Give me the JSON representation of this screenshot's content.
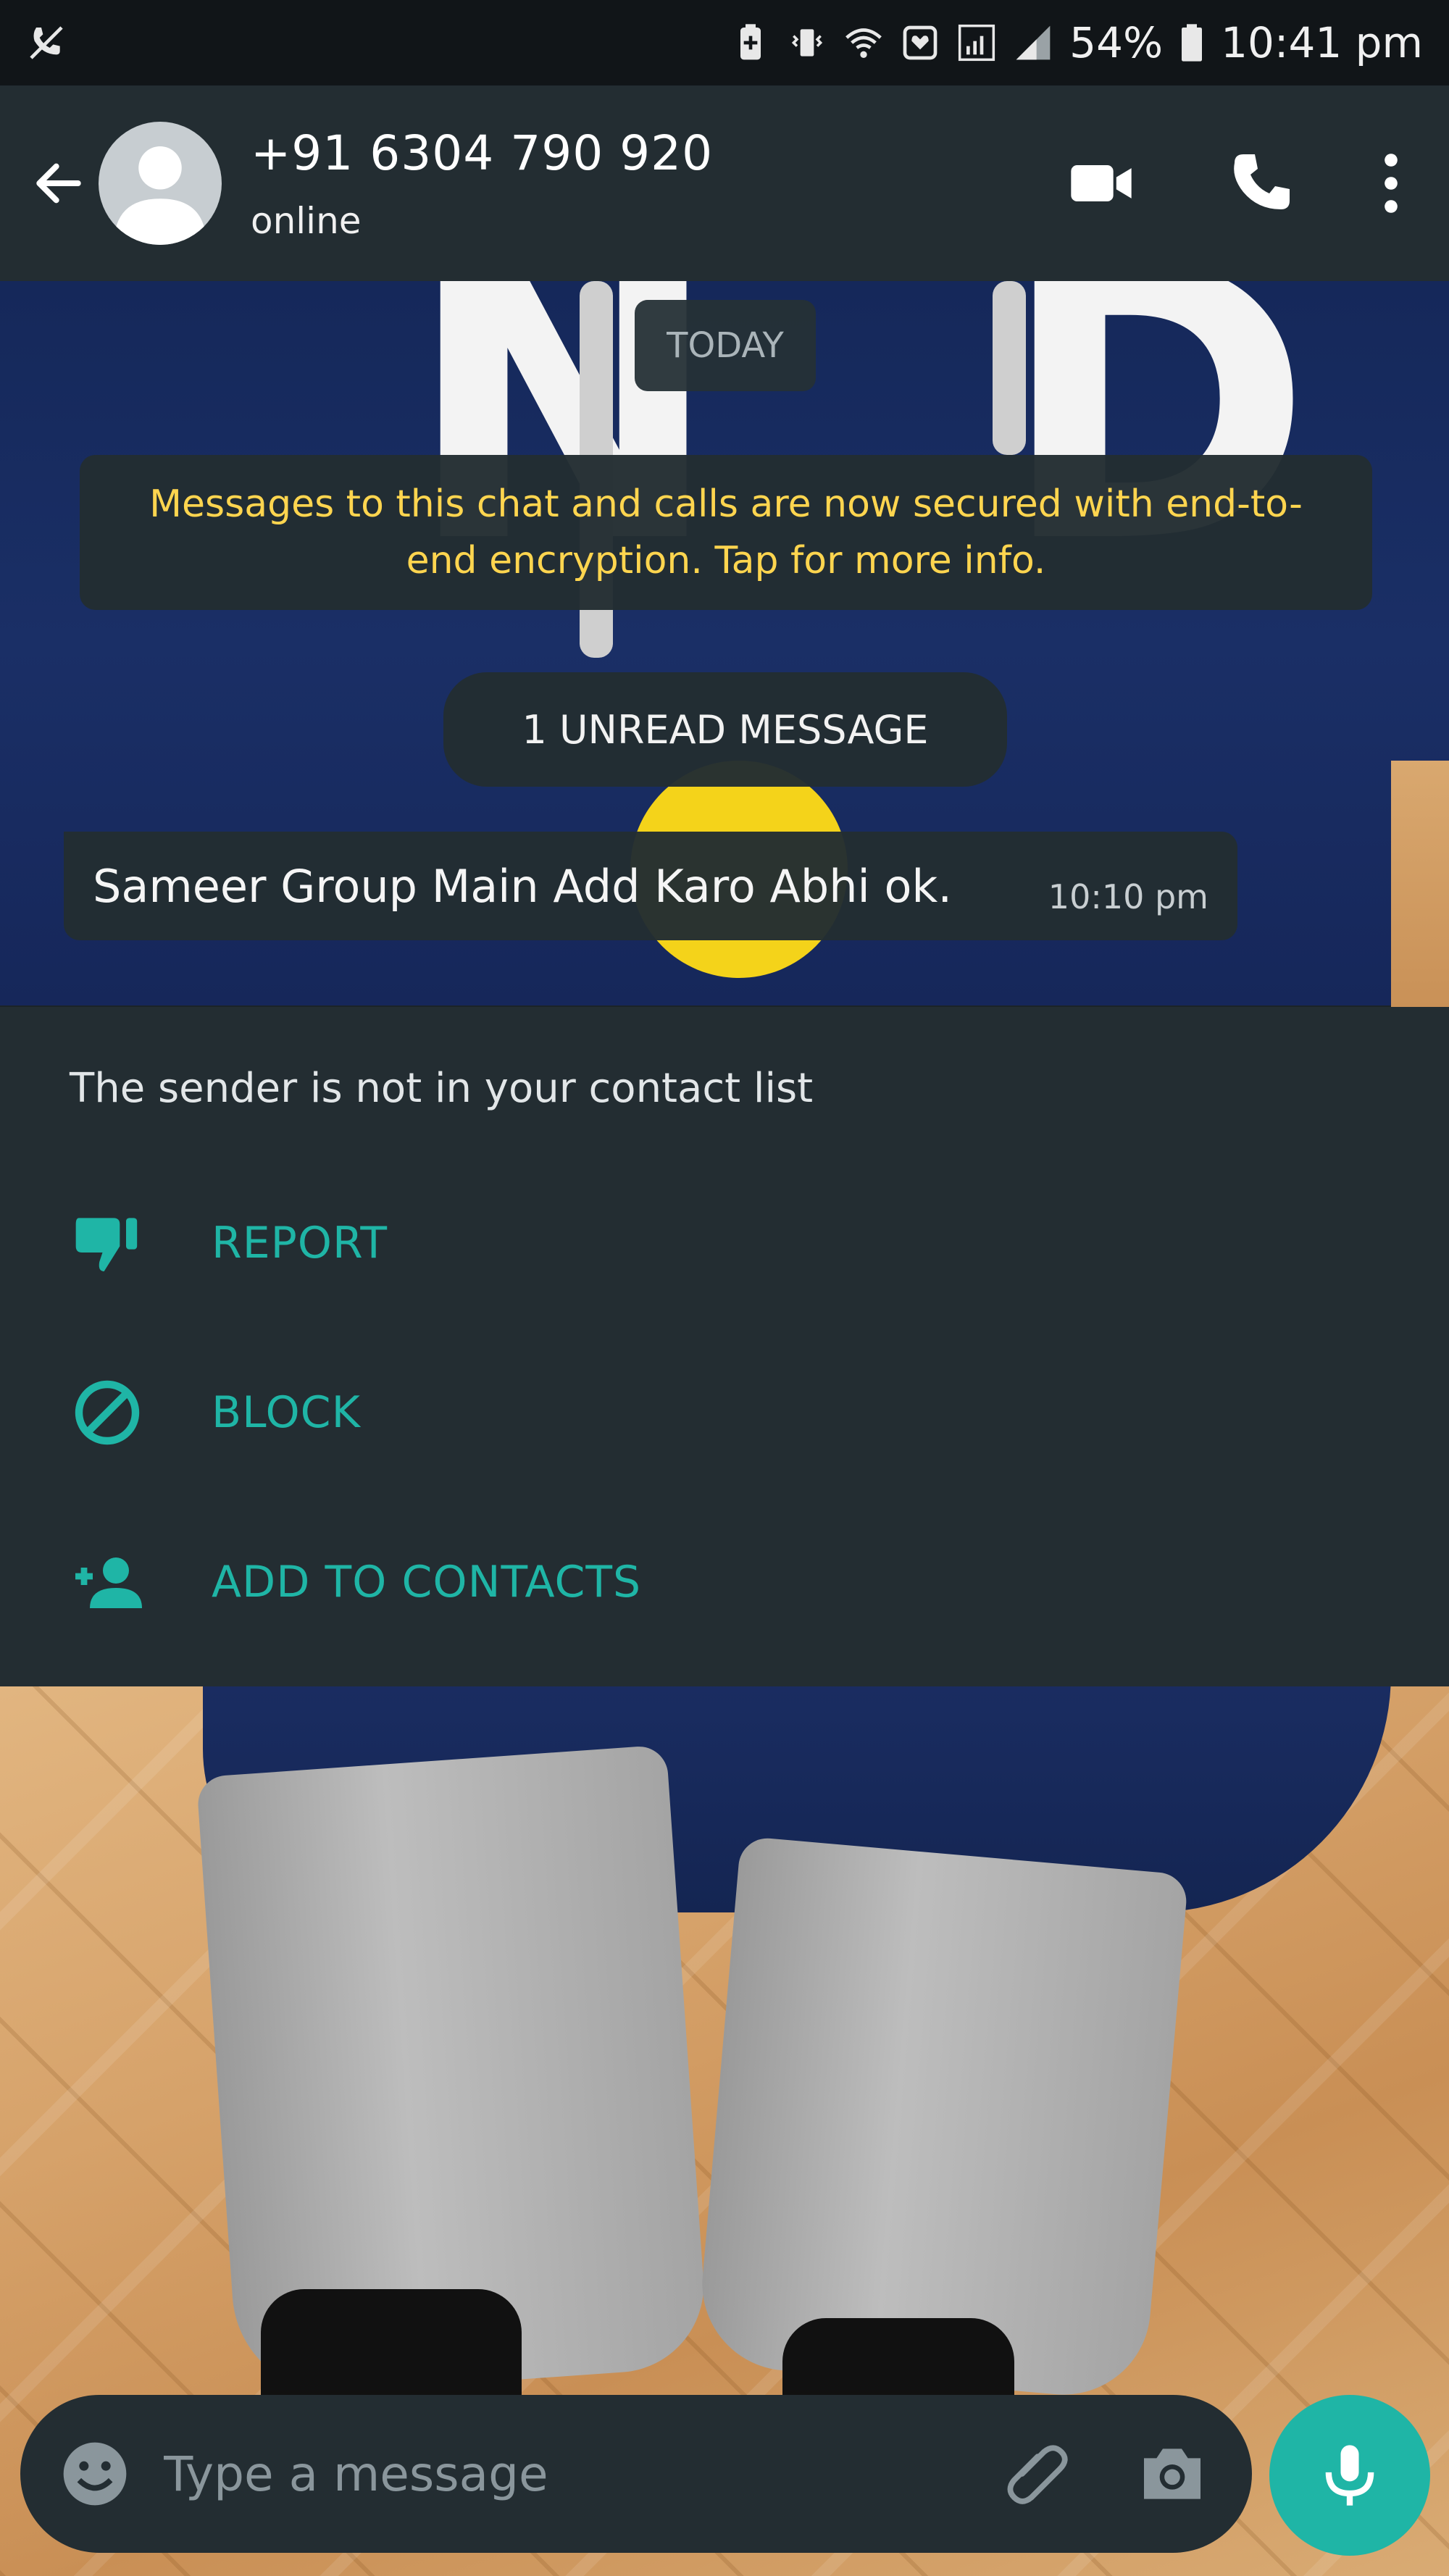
{
  "status_bar": {
    "battery": "54%",
    "time": "10:41 pm",
    "icons": [
      "no-phone-icon",
      "battery-saver-icon",
      "vibrate-icon",
      "wifi-icon",
      "notification-icon",
      "signal-icon"
    ]
  },
  "header": {
    "contact_number": "+91 6304 790 920",
    "contact_status": "online",
    "actions": [
      "video-call-icon",
      "voice-call-icon",
      "more-options-icon"
    ]
  },
  "chat": {
    "date_label": "TODAY",
    "encryption_notice": "Messages to this chat and calls are now secured with end-to-end encryption. Tap for more info.",
    "unread_label": "1 UNREAD MESSAGE",
    "messages": [
      {
        "text": "Sameer Group Main Add Karo Abhi  ok.",
        "time": "10:10 pm",
        "direction": "incoming"
      }
    ]
  },
  "unknown_sender": {
    "title": "The sender is not in your contact list",
    "actions": [
      {
        "label": "REPORT",
        "icon": "thumbs-down-icon"
      },
      {
        "label": "BLOCK",
        "icon": "block-icon"
      },
      {
        "label": "ADD TO CONTACTS",
        "icon": "add-contact-icon"
      }
    ]
  },
  "composer": {
    "placeholder": "Type a message",
    "icons": [
      "emoji-icon",
      "attach-icon",
      "camera-icon",
      "mic-icon"
    ]
  },
  "colors": {
    "accent": "#1fb5a6",
    "header_bg": "#232d32",
    "notice_text": "#ffd54f"
  }
}
